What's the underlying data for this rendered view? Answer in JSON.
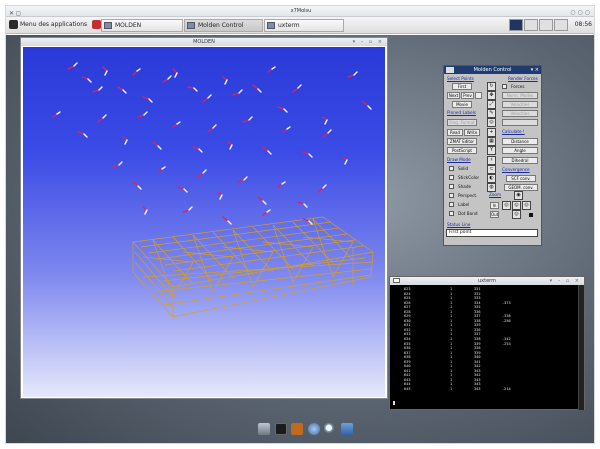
{
  "topbar": {
    "title": "x7Molsu"
  },
  "panel": {
    "app_menu": "Menu des applications",
    "tasks": [
      {
        "label": "MOLDEN",
        "active": false
      },
      {
        "label": "Molden Control",
        "active": true
      },
      {
        "label": "uxterm",
        "active": false
      }
    ],
    "clock": "08:56"
  },
  "molden_window": {
    "title": "MOLDEN"
  },
  "control": {
    "title": "Molden Control",
    "select_points": "Select Points",
    "render_forces": "Render Forces",
    "first": "First",
    "forces": "Forces",
    "next": "Next",
    "prev": "Prev",
    "movie": "Movie",
    "mode_sel": "Mode sel.",
    "norm_modes": "Norm. Modes",
    "velocities": "Velocities",
    "movie_label": "Movie",
    "pinned_label": "Pinned Labels",
    "freq_format": "Freq. Format",
    "read": "Read",
    "write": "Write",
    "zmat_editor": "ZMAT Editor",
    "calculate": "Calculate !",
    "distance": "Distance",
    "postscript": "PostScript",
    "angle": "Angle",
    "draw_mode": "Draw Mode",
    "dihedral": "Dihedral",
    "solid": "Solid",
    "convergence": "Convergence",
    "stick_color": "StickColor",
    "scf_conv": "SCF conv.",
    "shade": "Shade",
    "geom_conv": "GEOM. conv.",
    "perspect": "Perspect.",
    "zoom": "Zoom",
    "label": "Label",
    "in": "In",
    "out": "Out",
    "dot_bond": "Dot Bond",
    "status_line": "Status Line",
    "status_text": "First point"
  },
  "terminal": {
    "title": "uxterm",
    "rows": [
      [
        "623",
        "1",
        "331",
        ""
      ],
      [
        "624",
        "1",
        "332",
        ""
      ],
      [
        "625",
        "1",
        "333",
        ""
      ],
      [
        "626",
        "1",
        "334",
        "-373"
      ],
      [
        "627",
        "1",
        "335",
        ""
      ],
      [
        "628",
        "1",
        "336",
        ""
      ],
      [
        "629",
        "1",
        "337",
        "-336"
      ],
      [
        "630",
        "1",
        "338",
        "-256"
      ],
      [
        "631",
        "1",
        "339",
        ""
      ],
      [
        "632",
        "1",
        "336",
        ""
      ],
      [
        "633",
        "1",
        "337",
        ""
      ],
      [
        "634",
        "1",
        "338",
        "-342"
      ],
      [
        "635",
        "1",
        "339",
        "-253"
      ],
      [
        "636",
        "1",
        "338",
        ""
      ],
      [
        "637",
        "1",
        "339",
        ""
      ],
      [
        "638",
        "1",
        "340",
        ""
      ],
      [
        "639",
        "1",
        "341",
        ""
      ],
      [
        "640",
        "1",
        "342",
        ""
      ],
      [
        "641",
        "1",
        "343",
        ""
      ],
      [
        "642",
        "1",
        "342",
        ""
      ],
      [
        "643",
        "1",
        "343",
        ""
      ],
      [
        "644",
        "1",
        "343",
        ""
      ],
      [
        "645",
        "1",
        "343",
        "-214"
      ]
    ]
  },
  "dock": {
    "icons": [
      "computer-icon",
      "terminal-icon",
      "archive-icon",
      "globe-icon",
      "search-icon",
      "folder-icon"
    ]
  }
}
